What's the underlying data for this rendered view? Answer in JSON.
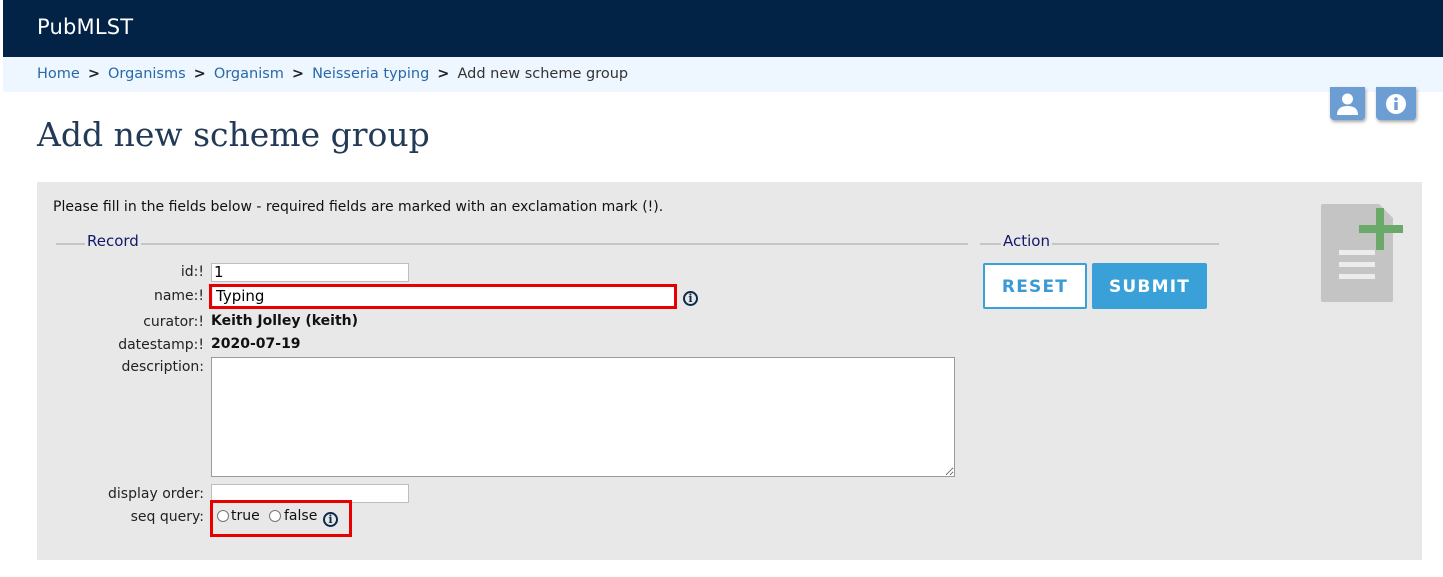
{
  "site": {
    "title": "PubMLST"
  },
  "breadcrumb": {
    "items": [
      "Home",
      "Organisms",
      "Organism",
      "Neisseria typing"
    ],
    "current": "Add new scheme group",
    "separator": ">"
  },
  "page": {
    "heading": "Add new scheme group"
  },
  "form": {
    "instructions": "Please fill in the fields below - required fields are marked with an exclamation mark (!).",
    "record_legend": "Record",
    "action_legend": "Action",
    "fields": {
      "id": {
        "label": "id:!",
        "value": "1"
      },
      "name": {
        "label": "name:!",
        "value": "Typing"
      },
      "curator": {
        "label": "curator:!",
        "value": "Keith Jolley (keith)"
      },
      "datestamp": {
        "label": "datestamp:!",
        "value": "2020-07-19"
      },
      "description": {
        "label": "description:",
        "value": ""
      },
      "display_order": {
        "label": "display order:",
        "value": ""
      },
      "seq_query": {
        "label": "seq query:",
        "options": [
          "true",
          "false"
        ],
        "selected": null
      }
    },
    "buttons": {
      "reset": "RESET",
      "submit": "SUBMIT"
    }
  },
  "icons": {
    "user": "user-icon",
    "info": "info-icon",
    "add_document": "add-document-icon",
    "field_info": "info-circle-icon"
  },
  "colors": {
    "header_bg": "#022346",
    "breadcrumb_bg": "#eef6ff",
    "link": "#2869a8",
    "accent": "#3aa0d8",
    "highlight": "#e60000"
  }
}
